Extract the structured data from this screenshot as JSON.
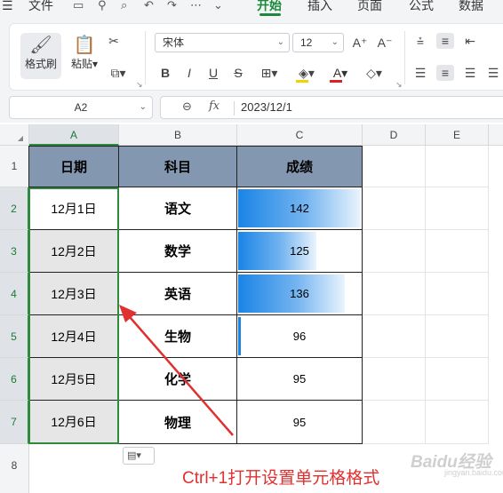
{
  "menubar": {
    "file_label": "文件",
    "tabs": [
      "开始",
      "插入",
      "页面",
      "公式",
      "数据"
    ],
    "active_tab": "开始"
  },
  "ribbon": {
    "format_painter": "格式刷",
    "paste": "粘贴",
    "font_name": "宋体",
    "font_size": "12"
  },
  "formula_bar": {
    "name_box": "A2",
    "fx": "fx",
    "value": "2023/12/1"
  },
  "sheet": {
    "columns": [
      "A",
      "B",
      "C",
      "D",
      "E"
    ],
    "rows": [
      "1",
      "2",
      "3",
      "4",
      "5",
      "6",
      "7",
      "8"
    ],
    "header": [
      "日期",
      "科目",
      "成绩"
    ],
    "data": [
      {
        "date": "12月1日",
        "subject": "语文",
        "score": "142",
        "bar": 1.0
      },
      {
        "date": "12月2日",
        "subject": "数学",
        "score": "125",
        "bar": 0.64
      },
      {
        "date": "12月3日",
        "subject": "英语",
        "score": "136",
        "bar": 0.87
      },
      {
        "date": "12月4日",
        "subject": "生物",
        "score": "96",
        "bar": 0.02
      },
      {
        "date": "12月5日",
        "subject": "化学",
        "score": "95",
        "bar": 0.0
      },
      {
        "date": "12月6日",
        "subject": "物理",
        "score": "95",
        "bar": 0.0
      }
    ]
  },
  "annotation": "Ctrl+1打开设置单元格格式",
  "watermark": "Baidu经验",
  "watermark_sub": "jingyan.baidu.com",
  "colors": {
    "accent_green": "#1a8a3a",
    "header_fill": "#8497b0",
    "databar_blue": "#1a84e6",
    "annotation_red": "#e03030"
  }
}
